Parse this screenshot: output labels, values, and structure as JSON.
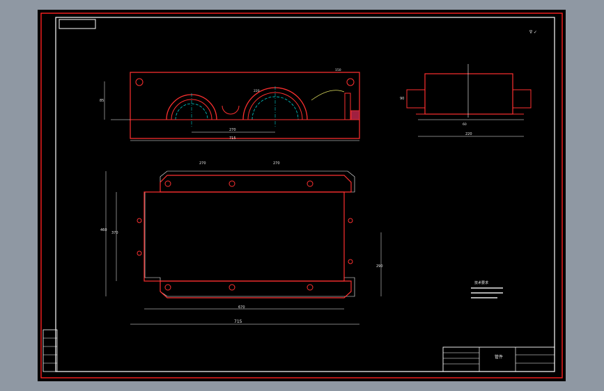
{
  "drawing": {
    "roughness_mark": "∇ ✓",
    "front_view": {
      "dims": {
        "overall_length": "715",
        "span": "270",
        "height": "85",
        "sec_a": "220",
        "sec_b": "150"
      }
    },
    "side_view": {
      "dims": {
        "width": "220",
        "height": "90",
        "inner": "60"
      }
    },
    "top_view": {
      "dims": {
        "top_left_gap": "270",
        "top_right_gap": "270",
        "overall_length": "715",
        "inner_length": "670",
        "overall_height": "460",
        "inner_height": "370",
        "right_height": "290"
      }
    },
    "tech_notes": {
      "title": "技术要求"
    },
    "title_block": {
      "label": "管件"
    }
  }
}
